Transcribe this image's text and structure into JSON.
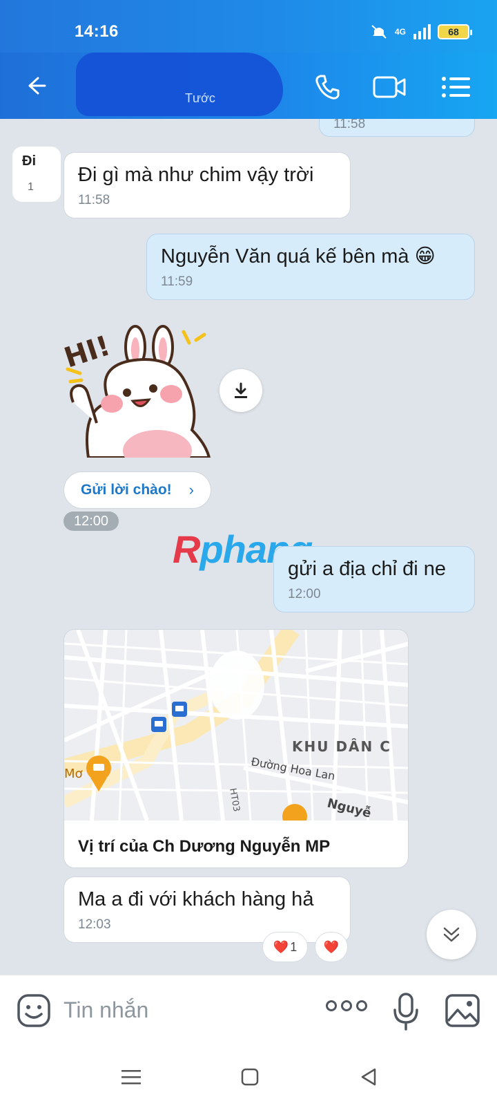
{
  "status_bar": {
    "time": "14:16",
    "network": "4G",
    "battery": "68"
  },
  "header": {
    "subtitle": "Tước"
  },
  "messages": [
    {
      "time": "11:58"
    },
    {
      "avatar_text": "Đi",
      "avatar_num": "1",
      "text": "Đi gì mà như chim vậy trời",
      "time": "11:58"
    },
    {
      "text": "Nguyễn Văn quá kế bên mà 😁",
      "time": "11:59"
    },
    {
      "sticker_text": "HI!"
    },
    {
      "text": "gửi a địa chỉ đi ne",
      "time": "12:00"
    },
    {
      "text": "Ma a đi với khách hàng hả",
      "time": "12:03"
    }
  ],
  "hello_button": {
    "label": "Gửi lời chào!",
    "chevron": "›"
  },
  "time_pill": "12:00",
  "watermark": {
    "first": "R",
    "rest": "phang"
  },
  "map": {
    "caption": "Vị trí của Ch Dương Nguyễn MP",
    "label_area": "KHU DÂN C",
    "label_street": "Đường Hoa Lan",
    "label_street2": "Nguyễ",
    "label_road": "HT03",
    "label_place": "Mơ"
  },
  "reactions": [
    {
      "emoji": "❤️",
      "count": "1"
    },
    {
      "emoji": "❤️",
      "count": ""
    }
  ],
  "input": {
    "placeholder": "Tin nhắn"
  },
  "icons": {
    "back": "arrow-left-icon",
    "call": "phone-icon",
    "video": "video-camera-icon",
    "menu": "list-menu-icon",
    "download": "download-icon",
    "scroll": "double-chevron-down-icon",
    "emoji": "sticker-face-icon",
    "more": "more-dots-icon",
    "mic": "microphone-icon",
    "image": "image-icon"
  },
  "colors": {
    "header": "#1d87ea",
    "outgoing_bubble": "#d6ecfb",
    "incoming_bubble": "#ffffff",
    "background": "#dfe4ea",
    "link": "#1e77c7"
  }
}
